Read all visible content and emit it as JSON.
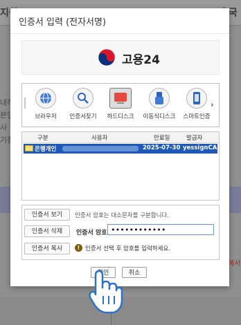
{
  "background": {
    "left_top": "지원",
    "right_top": "출국",
    "left_column": [
      "내하",
      "본인",
      "사",
      "기장"
    ],
    "right_note": "에서"
  },
  "dialog": {
    "title": "인증서 입력 (전자서명)",
    "brand": {
      "name": "고용24"
    },
    "media": [
      {
        "label": "브라우저",
        "icon": "globe-icon"
      },
      {
        "label": "인증서찾기",
        "icon": "search-icon"
      },
      {
        "label": "하드디스크",
        "icon": "hard-disk-icon",
        "selected": true
      },
      {
        "label": "이동식디스크",
        "icon": "usb-icon"
      },
      {
        "label": "스마트인증",
        "icon": "smartphone-icon"
      }
    ],
    "table": {
      "headers": [
        "구분",
        "사용자",
        "만료일",
        "발급자"
      ],
      "rows": [
        {
          "type": "은행개인",
          "user": "",
          "expiry": "2025-07-30",
          "issuer": "yessignCA ..."
        }
      ]
    },
    "actions": {
      "view": "인증서 보기",
      "delete": "인증서 삭제",
      "copy": "인증서 복사",
      "case_note": "인증서 암호는 대소문자를 구분합니다.",
      "password_label": "인증서 암호",
      "password_value": "••••••••••••",
      "hint": "인증서 선택 후 암호를 입력하세요."
    },
    "footer": {
      "ok": "확인",
      "cancel": "취소"
    }
  },
  "colors": {
    "accent": "#1f58b6",
    "selected_row_text": "#ffffff"
  }
}
